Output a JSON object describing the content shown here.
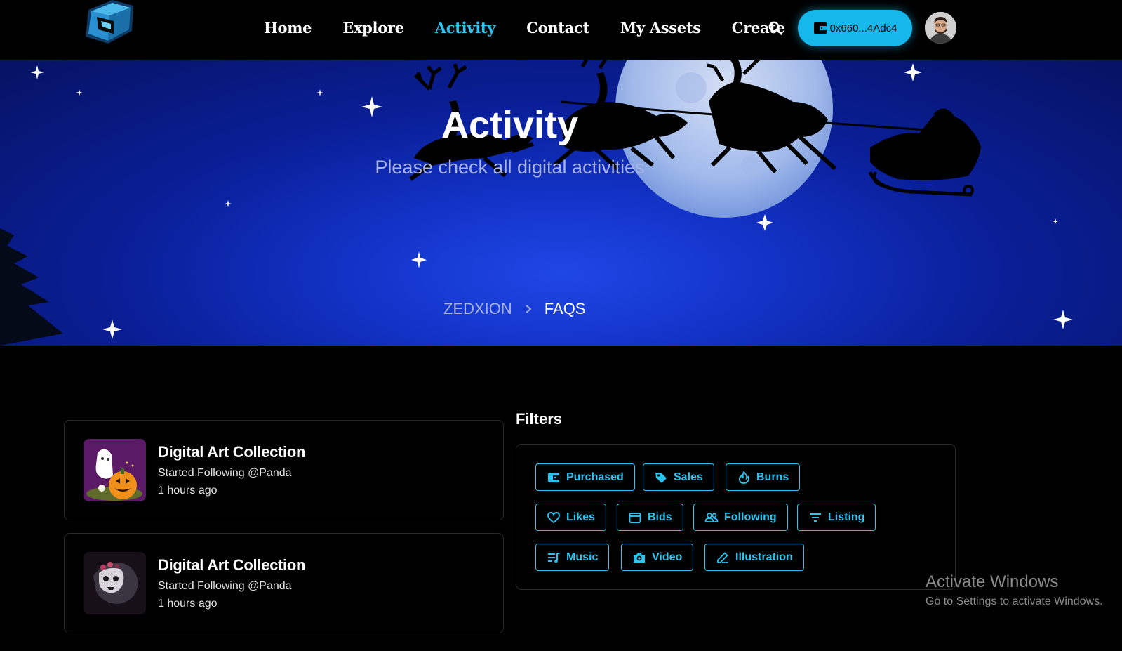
{
  "nav": {
    "links": [
      "Home",
      "Explore",
      "Activity",
      "Contact",
      "My Assets",
      "Create"
    ],
    "active": "Activity",
    "wallet_label": "0x660...4Adc4",
    "accent": "#2bc4f0"
  },
  "hero": {
    "title": "Activity",
    "subtitle": "Please check all digital activities",
    "breadcrumb": [
      "ZEDXION",
      "FAQS"
    ]
  },
  "activities": [
    {
      "title": "Digital Art Collection",
      "subtitle": "Started Following @Panda",
      "time": "1 hours ago",
      "thumb": "halloween-ghost-pumpkin"
    },
    {
      "title": "Digital Art Collection",
      "subtitle": "Started Following @Panda",
      "time": "1 hours ago",
      "thumb": "skull-wolf"
    }
  ],
  "filters": {
    "title": "Filters",
    "chips": [
      {
        "label": "Purchased",
        "icon": "wallet-icon"
      },
      {
        "label": "Sales",
        "icon": "tag-icon"
      },
      {
        "label": "Burns",
        "icon": "fire-icon"
      },
      {
        "label": "Likes",
        "icon": "heart-icon"
      },
      {
        "label": "Bids",
        "icon": "calendar-icon"
      },
      {
        "label": "Following",
        "icon": "people-icon"
      },
      {
        "label": "Listing",
        "icon": "filter-icon"
      },
      {
        "label": "Music",
        "icon": "playlist-icon"
      },
      {
        "label": "Video",
        "icon": "camera-icon"
      },
      {
        "label": "Illustration",
        "icon": "pen-icon"
      }
    ]
  },
  "watermark": {
    "line1": "Activate Windows",
    "line2": "Go to Settings to activate Windows."
  }
}
